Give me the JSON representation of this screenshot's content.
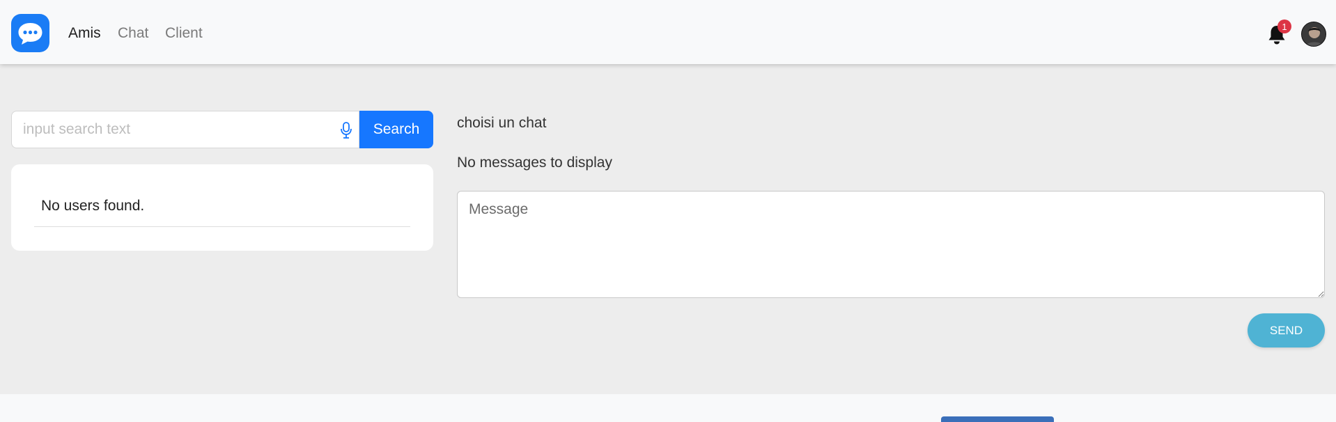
{
  "navbar": {
    "logo_icon": "chat-bubble-icon",
    "links": [
      {
        "label": "Amis",
        "active": true
      },
      {
        "label": "Chat",
        "active": false
      },
      {
        "label": "Client",
        "active": false
      }
    ],
    "notifications": {
      "icon": "bell-icon",
      "count": "1"
    },
    "avatar_icon": "user-avatar"
  },
  "search": {
    "placeholder": "input search text",
    "value": "",
    "mic_icon": "microphone-icon",
    "button_label": "Search"
  },
  "users": {
    "empty_text": "No users found."
  },
  "chat": {
    "title": "choisi un chat",
    "empty_text": "No messages to display",
    "message_placeholder": "Message",
    "send_label": "SEND"
  },
  "colors": {
    "primary": "#1677ff",
    "send": "#4fb3d4",
    "badge": "#dc3545",
    "background": "#ededed"
  }
}
